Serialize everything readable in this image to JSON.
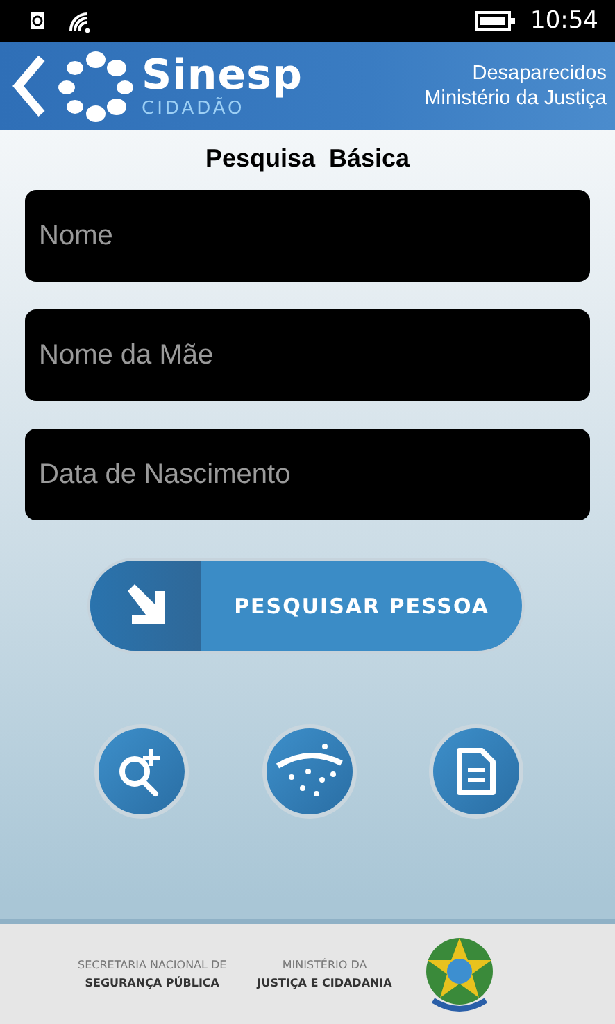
{
  "status_bar": {
    "time": "10:54"
  },
  "header": {
    "logo_text": "Sinesp",
    "logo_subtext": "CIDADÃO",
    "lines": [
      "Desaparecidos",
      "Ministério da Justiça"
    ]
  },
  "title": "Pesquisa  Básica",
  "fields": [
    {
      "placeholder": "Nome"
    },
    {
      "placeholder": "Nome da Mãe"
    },
    {
      "placeholder": "Data de Nascimento"
    }
  ],
  "search_button": {
    "label": "PESQUISAR PESSOA"
  },
  "round_buttons": [
    {
      "kind": "zoom"
    },
    {
      "kind": "stars"
    },
    {
      "kind": "document"
    }
  ],
  "footer": {
    "blocks": [
      {
        "top": "SECRETARIA NACIONAL DE",
        "bottom": "SEGURANÇA PÚBLICA"
      },
      {
        "top": "MINISTÉRIO DA",
        "bottom": "JUSTIÇA E CIDADANIA"
      }
    ]
  }
}
